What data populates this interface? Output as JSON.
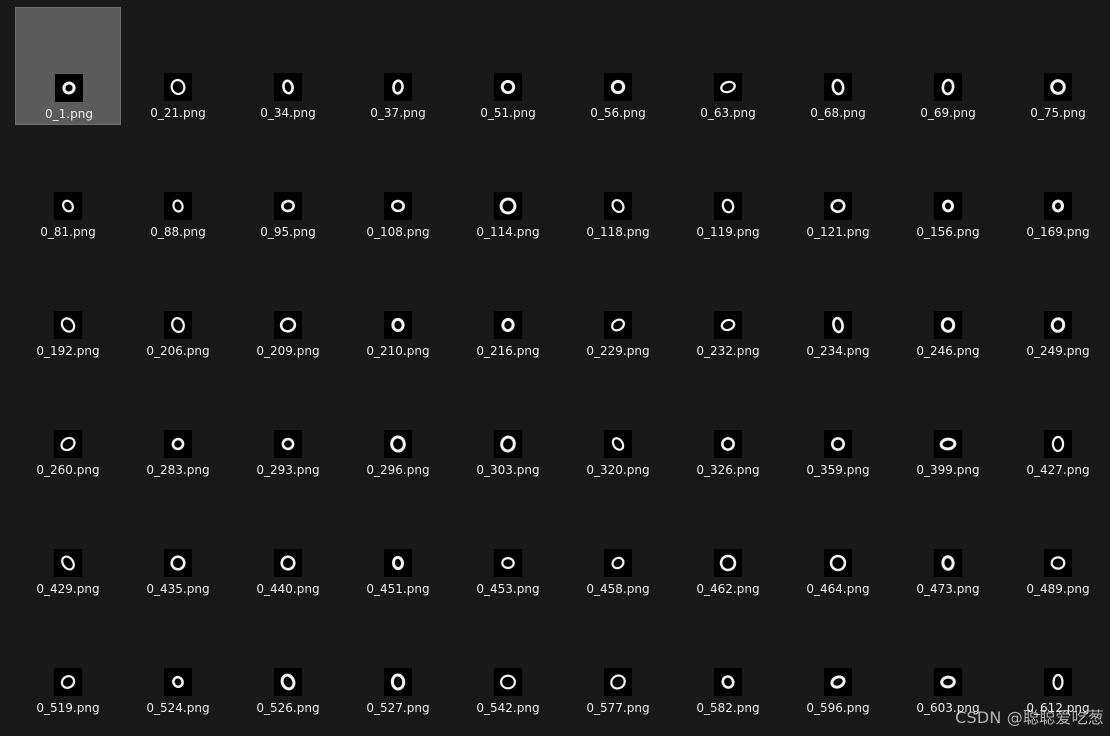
{
  "explorer": {
    "background": "#191919",
    "selected_background": "#5c5c5c",
    "selected_index": 0,
    "items": [
      {
        "name": "0_1.png"
      },
      {
        "name": "0_21.png"
      },
      {
        "name": "0_34.png"
      },
      {
        "name": "0_37.png"
      },
      {
        "name": "0_51.png"
      },
      {
        "name": "0_56.png"
      },
      {
        "name": "0_63.png"
      },
      {
        "name": "0_68.png"
      },
      {
        "name": "0_69.png"
      },
      {
        "name": "0_75.png"
      },
      {
        "name": "0_81.png"
      },
      {
        "name": "0_88.png"
      },
      {
        "name": "0_95.png"
      },
      {
        "name": "0_108.png"
      },
      {
        "name": "0_114.png"
      },
      {
        "name": "0_118.png"
      },
      {
        "name": "0_119.png"
      },
      {
        "name": "0_121.png"
      },
      {
        "name": "0_156.png"
      },
      {
        "name": "0_169.png"
      },
      {
        "name": "0_192.png"
      },
      {
        "name": "0_206.png"
      },
      {
        "name": "0_209.png"
      },
      {
        "name": "0_210.png"
      },
      {
        "name": "0_216.png"
      },
      {
        "name": "0_229.png"
      },
      {
        "name": "0_232.png"
      },
      {
        "name": "0_234.png"
      },
      {
        "name": "0_246.png"
      },
      {
        "name": "0_249.png"
      },
      {
        "name": "0_260.png"
      },
      {
        "name": "0_283.png"
      },
      {
        "name": "0_293.png"
      },
      {
        "name": "0_296.png"
      },
      {
        "name": "0_303.png"
      },
      {
        "name": "0_320.png"
      },
      {
        "name": "0_326.png"
      },
      {
        "name": "0_359.png"
      },
      {
        "name": "0_399.png"
      },
      {
        "name": "0_427.png"
      },
      {
        "name": "0_429.png"
      },
      {
        "name": "0_435.png"
      },
      {
        "name": "0_440.png"
      },
      {
        "name": "0_451.png"
      },
      {
        "name": "0_453.png"
      },
      {
        "name": "0_458.png"
      },
      {
        "name": "0_462.png"
      },
      {
        "name": "0_464.png"
      },
      {
        "name": "0_473.png"
      },
      {
        "name": "0_489.png"
      },
      {
        "name": "0_519.png"
      },
      {
        "name": "0_524.png"
      },
      {
        "name": "0_526.png"
      },
      {
        "name": "0_527.png"
      },
      {
        "name": "0_542.png"
      },
      {
        "name": "0_577.png"
      },
      {
        "name": "0_582.png"
      },
      {
        "name": "0_596.png"
      },
      {
        "name": "0_603.png"
      },
      {
        "name": "0_612.png"
      }
    ]
  },
  "watermark": "CSDN @聪聪爱吃葱"
}
